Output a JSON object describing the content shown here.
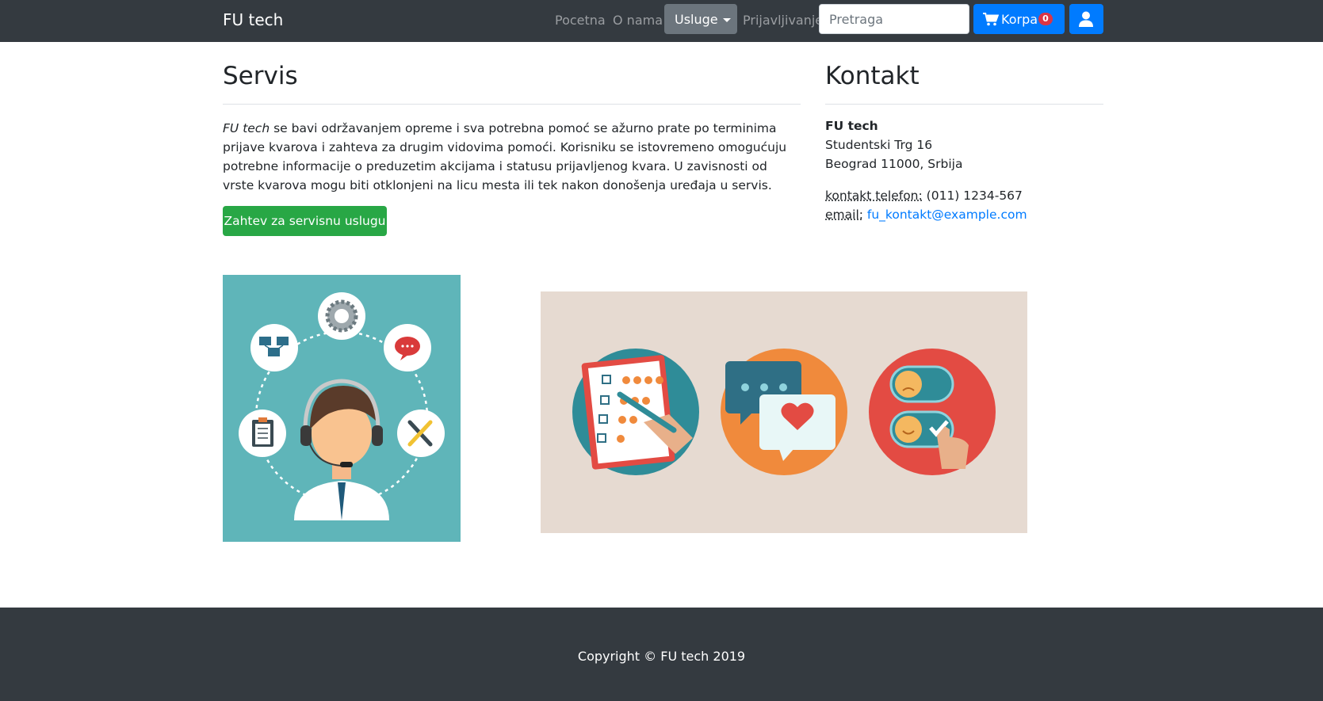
{
  "navbar": {
    "brand": "FU tech",
    "links": [
      "Pocetna",
      "O nama"
    ],
    "dropdown_label": "Usluge",
    "login_link": "Prijavljivanje",
    "search_placeholder": "Pretraga",
    "cart_label": "Korpa",
    "cart_count": "0",
    "colors": {
      "bg": "#343a40",
      "primary": "#007bff",
      "secondary": "#6c757d",
      "badge": "#dc3545"
    }
  },
  "servis": {
    "title": "Servis",
    "intro_em": "FU tech",
    "intro_text": " se bavi održavanjem opreme i sva potrebna pomoć se ažurno prate po terminima prijave kvarova i zahteva za drugim vidovima pomoći. Korisniku se istovremeno omogućuju potrebne informacije o preduzetim akcijama i statusu prijavljenog kvara. U zavisnosti od vrste kvarova mogu biti otklonjeni na licu mesta ili tek nakon donošenja uređaja u servis.",
    "request_button": "Zahtev za servisnu uslugu",
    "button_color": "#28a745"
  },
  "kontakt": {
    "title": "Kontakt",
    "company": "FU tech",
    "street": "Studentski Trg 16",
    "city": "Beograd 11000, Srbija",
    "phone_label": "kontakt telefon:",
    "phone": "(011) 1234-567",
    "email_label": "email:",
    "email": "fu_kontakt@example.com"
  },
  "illustrations": {
    "support": "support-agent-illustration",
    "feedback": "feedback-illustration"
  },
  "footer": {
    "copyright": "Copyright © FU tech 2019"
  }
}
